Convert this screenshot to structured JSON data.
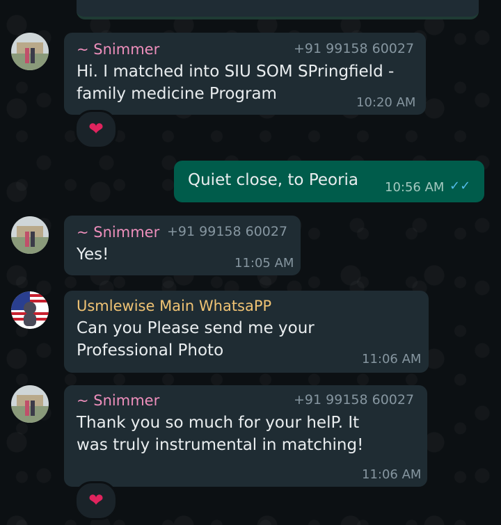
{
  "messages": [
    {
      "sender": "~ Snimmer",
      "phone": "+91 99158 60027",
      "lines": [
        "Hi. I matched into SIU SOM SPringfield -",
        "family medicine Program"
      ],
      "time": "10:20 AM",
      "reaction": "❤"
    },
    {
      "text": "Quiet close,  to Peoria",
      "time": "10:56 AM",
      "status": "✓✓"
    },
    {
      "sender": "~ Snimmer",
      "phone": "+91 99158 60027",
      "lines": [
        "Yes!"
      ],
      "time": "11:05 AM"
    },
    {
      "sender": "Usmlewise Main WhatsaPP",
      "lines": [
        "Can you Please send me your",
        "Professional Photo"
      ],
      "time": "11:06 AM"
    },
    {
      "sender": "~ Snimmer",
      "phone": "+91 99158 60027",
      "lines": [
        "Thank you so much for your helP. It",
        "was truly instrumental in matching!"
      ],
      "time": "11:06 AM",
      "reaction": "❤"
    }
  ],
  "colors": {
    "incoming_bubble": "#1f2c33",
    "outgoing_bubble": "#005c4b",
    "sender_pink": "#ee8fbc",
    "sender_gold": "#f0c374",
    "read_ticks": "#53bdeb"
  }
}
